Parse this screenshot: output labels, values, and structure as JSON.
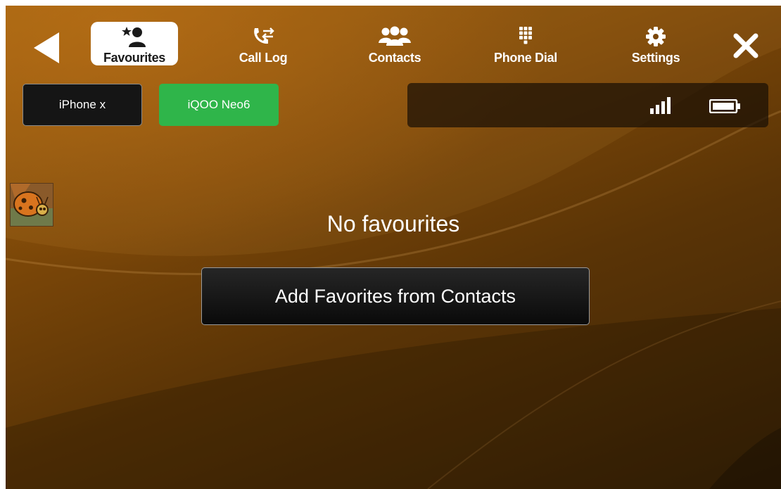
{
  "nav": {
    "tabs": [
      {
        "label": "Favourites",
        "icon": "favourite-contact-icon",
        "active": true
      },
      {
        "label": "Call Log",
        "icon": "call-log-icon",
        "active": false
      },
      {
        "label": "Contacts",
        "icon": "contacts-icon",
        "active": false
      },
      {
        "label": "Phone Dial",
        "icon": "dialpad-icon",
        "active": false
      },
      {
        "label": "Settings",
        "icon": "gear-icon",
        "active": false
      }
    ],
    "back_icon": "back-arrow-icon",
    "close_icon": "close-icon"
  },
  "devices": [
    {
      "label": "iPhone x",
      "selected": false
    },
    {
      "label": "iQOO Neo6",
      "selected": true
    }
  ],
  "status": {
    "signal_icon": "signal-bars-icon",
    "battery_icon": "battery-icon"
  },
  "main": {
    "empty_message": "No favourites",
    "add_button_label": "Add Favorites from Contacts"
  },
  "colors": {
    "accent_green": "#2fb54a",
    "background": "#7a4608"
  }
}
